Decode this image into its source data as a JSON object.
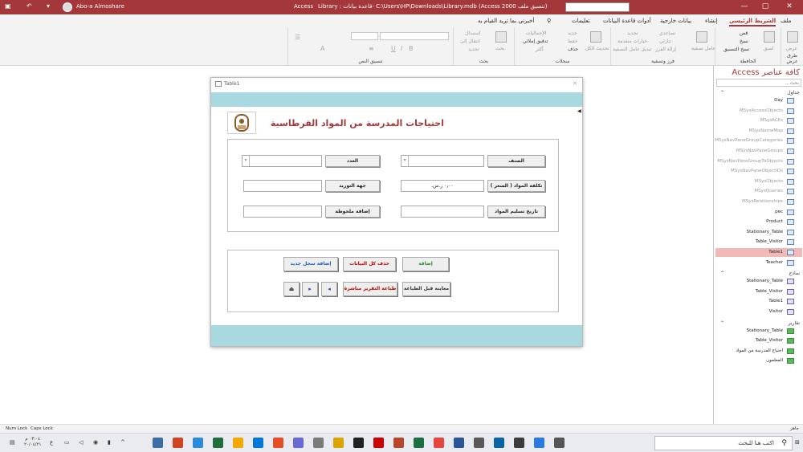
{
  "titlebar": {
    "user": "Abo-a Almoshare",
    "app": "Access",
    "file_path": "Library : قاعدة بيانات- C:\\Users\\HP\\Downloads\\Library.mdb (Access 2000 تنسيق ملف)"
  },
  "ribbon_tabs": [
    "ملف",
    "الشريط الرئيسي",
    "إنشاء",
    "بيانات خارجية",
    "أدوات قاعدة البيانات",
    "تعليمات",
    "أخبرني بما تريد القيام به"
  ],
  "ribbon": {
    "groups": {
      "views": "طرق عرض",
      "clipboard": "الحافظة",
      "sort_filter": "فرز وتصفية",
      "records": "سجلات",
      "find": "بحث",
      "text_format": "تنسيق النص"
    },
    "items": {
      "view": "عرض",
      "paste": "لصق",
      "cut": "قص",
      "copy": "نسخ",
      "format_painter": "نسخ التنسيق",
      "filter": "عامل تصفية",
      "ascending": "تصاعدي",
      "descending": "تنازلي",
      "remove_sort": "إزالة الفرز",
      "selection": "تحديد",
      "advanced": "خيارات متقدمة",
      "toggle_filter": "تبديل عامل التصفية",
      "refresh_all": "تحديث الكل",
      "new": "جديد",
      "save": "حفظ",
      "delete": "حذف",
      "totals": "الإجماليات",
      "spelling": "تدقيق إملائي",
      "more": "أكثر",
      "find": "بحث",
      "replace": "استبدال",
      "goto": "انتقال إلى",
      "select": "تحديد"
    }
  },
  "navpane": {
    "title": "كافة عناصر Access",
    "search_placeholder": "بحث...",
    "sections": [
      {
        "name": "جداول",
        "items": [
          {
            "label": "Day",
            "type": "table",
            "system": false
          },
          {
            "label": "MSysAccessObjects",
            "type": "table",
            "system": true
          },
          {
            "label": "MSysACEs",
            "type": "table",
            "system": true
          },
          {
            "label": "MSysNameMap",
            "type": "table",
            "system": true
          },
          {
            "label": "MSysNavPaneGroupCategories",
            "type": "table",
            "system": true
          },
          {
            "label": "MSysNavPaneGroups",
            "type": "table",
            "system": true
          },
          {
            "label": "MSysNavPaneGroupToObjects",
            "type": "table",
            "system": true
          },
          {
            "label": "MSysNavPaneObjectIDs",
            "type": "table",
            "system": true
          },
          {
            "label": "MSysObjects",
            "type": "table",
            "system": true
          },
          {
            "label": "MSysQueries",
            "type": "table",
            "system": true
          },
          {
            "label": "MSysRelationships",
            "type": "table",
            "system": true
          },
          {
            "label": "pec",
            "type": "table",
            "system": false
          },
          {
            "label": "Product",
            "type": "table",
            "system": false
          },
          {
            "label": "Stationary_Table",
            "type": "table",
            "system": false
          },
          {
            "label": "Table_Visitor",
            "type": "table",
            "system": false
          },
          {
            "label": "Table1",
            "type": "table",
            "system": false,
            "selected": true
          },
          {
            "label": "Teacher",
            "type": "table",
            "system": false
          }
        ]
      },
      {
        "name": "نماذج",
        "items": [
          {
            "label": "Stationary_Table",
            "type": "form",
            "system": false
          },
          {
            "label": "Table_Visitor",
            "type": "form",
            "system": false
          },
          {
            "label": "Table1",
            "type": "form",
            "system": false
          },
          {
            "label": "Visitor",
            "type": "form",
            "system": false
          }
        ]
      },
      {
        "name": "تقارير",
        "items": [
          {
            "label": "Stationary_Table",
            "type": "report",
            "system": false
          },
          {
            "label": "Table_Visitor",
            "type": "report",
            "system": false
          },
          {
            "label": "احتياج المدرسة من المواد",
            "type": "report",
            "system": false
          },
          {
            "label": "المعلمون",
            "type": "report",
            "system": false
          }
        ]
      }
    ]
  },
  "form": {
    "window_title": "Table1",
    "heading": "احتياجات المدرسة من المواد القرطاسية",
    "labels": {
      "class": "الصنف",
      "count": "العدد",
      "cost": "تكلفة المواد ( السعر )",
      "supplier": "جهة التوريد",
      "delivery_date": "تاريخ تسليم المواد",
      "add_note": "إضافة ملحوظة"
    },
    "values": {
      "cost": "٠٫٠٠ ر.س.‏"
    },
    "buttons": {
      "add": "إضافة",
      "delete_all": "حذف كل البيانات",
      "new_record": "إضافة سجل جديد",
      "preview": "معاينة قبل الطباعة",
      "print_direct": "طباعة التقرير مباشرة"
    }
  },
  "statusbar": {
    "num_lock": "Num Lock",
    "caps_lock": "Caps Lock",
    "ready": "جاهز"
  },
  "taskbar": {
    "search_placeholder": "اكتب هنا للبحث",
    "time": "٠٣:٠٤ م",
    "date": "٢٠/٠٤/٢١"
  }
}
